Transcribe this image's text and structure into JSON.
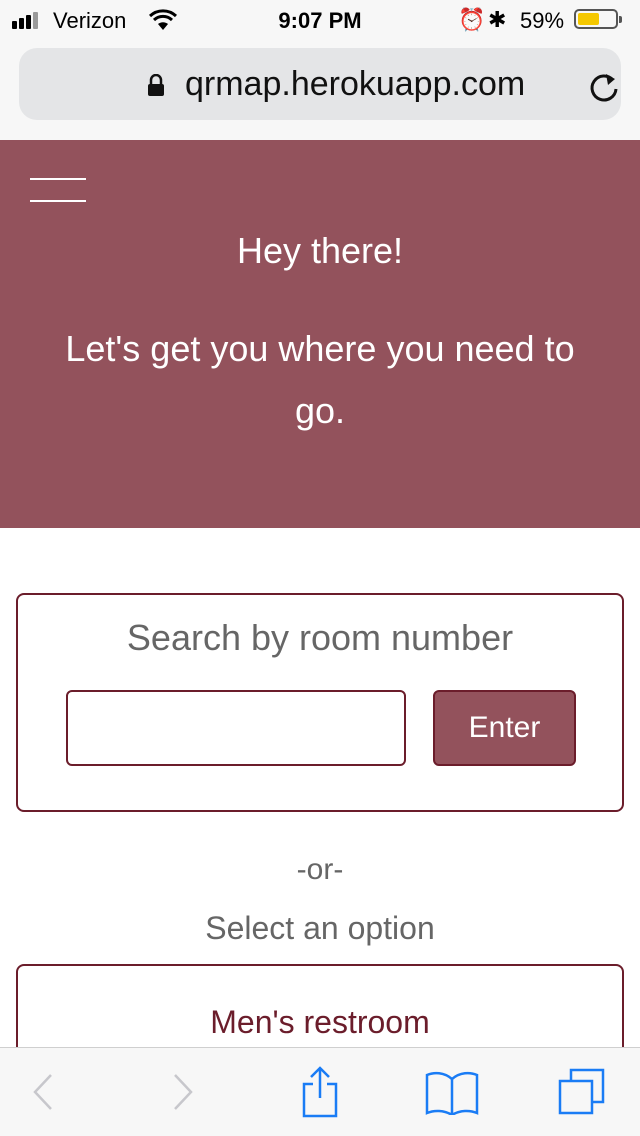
{
  "status_bar": {
    "carrier": "Verizon",
    "time": "9:07 PM",
    "battery_percent": "59%",
    "battery_level": 0.59,
    "icons": [
      "signal-icon",
      "wifi-icon",
      "alarm-icon",
      "bluetooth-icon",
      "battery-icon"
    ]
  },
  "browser": {
    "url": "qrmap.herokuapp.com",
    "toolbar_icons": [
      "back-icon",
      "forward-icon",
      "share-icon",
      "bookmarks-icon",
      "tabs-icon"
    ]
  },
  "hero": {
    "greeting": "Hey there!",
    "tagline": "Let's get you where you need to go."
  },
  "search": {
    "title": "Search by room number",
    "input_value": "",
    "input_placeholder": "",
    "button_label": "Enter"
  },
  "divider": "-or-",
  "select_label": "Select an option",
  "options": [
    {
      "label": "Men's restroom"
    }
  ],
  "colors": {
    "brand": "#93525c",
    "border": "#6b1d2b",
    "ios_blue": "#1a7cf5"
  }
}
